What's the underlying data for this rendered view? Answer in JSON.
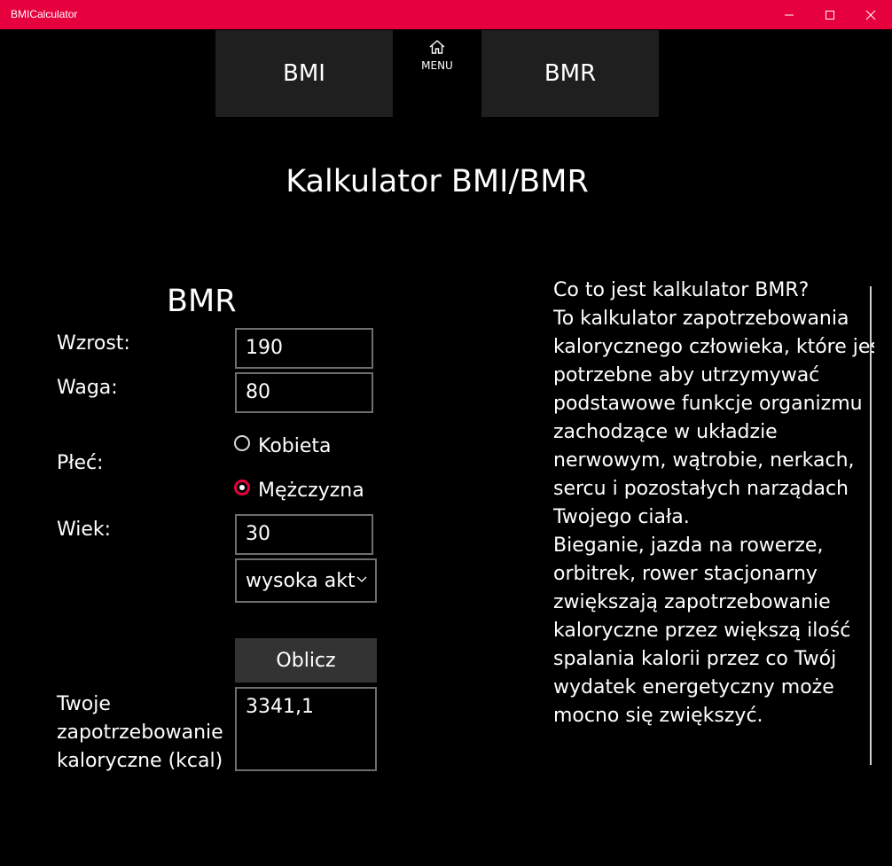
{
  "window": {
    "title": "BMICalculator",
    "accent_color": "#e6003e",
    "controls": [
      "minimize-icon",
      "maximize-icon",
      "close-icon"
    ]
  },
  "nav": {
    "bmi_label": "BMI",
    "menu_label": "MENU",
    "menu_icon": "home-icon",
    "bmr_label": "BMR"
  },
  "page": {
    "heading": "Kalkulator BMI/BMR",
    "section_title": "BMR"
  },
  "form": {
    "height_label": "Wzrost:",
    "height_value": "190",
    "weight_label": "Waga:",
    "weight_value": "80",
    "gender_label": "Płeć:",
    "gender_options": [
      {
        "label": "Kobieta",
        "checked": false
      },
      {
        "label": "Mężczyzna",
        "checked": true
      }
    ],
    "age_label": "Wiek:",
    "age_value": "30",
    "activity_selected": "wysoka akt",
    "calculate_label": "Oblicz",
    "result_label_lines": [
      "Twoje",
      "zapotrzebowanie",
      "kaloryczne (kcal)"
    ],
    "result_value": "3341,1"
  },
  "info": {
    "lines": [
      "Co to jest kalkulator BMR?",
      "To kalkulator zapotrzebowania",
      "kalorycznego człowieka, które jest",
      "potrzebne aby utrzymywać",
      "podstawowe funkcje organizmu",
      "zachodzące w układzie",
      "nerwowym, wątrobie, nerkach,",
      "sercu i pozostałych narządach",
      "Twojego ciała.",
      "Bieganie, jazda na rowerze,",
      "orbitrek, rower stacjonarny",
      "zwiększają zapotrzebowanie",
      "kaloryczne przez większą ilość",
      "spalania kalorii przez co Twój",
      "wydatek energetyczny może",
      "mocno się zwiększyć."
    ]
  }
}
